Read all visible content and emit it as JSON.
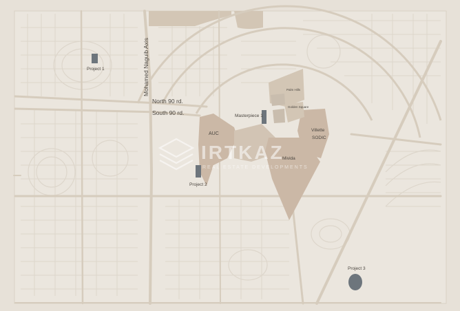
{
  "colors": {
    "background": "#e7e1d8",
    "map_fill": "#ebe6de",
    "road_major": "#d6ccbd",
    "road_minor": "#dcd5ca",
    "block_fill": "#d3c6b5",
    "district_fill": "#cbb8a6",
    "project_marker": "#6d757c",
    "label_text": "#4c4741",
    "watermark": "#ffffff"
  },
  "roads": {
    "mohamed_naguib": "Mohamed Naguib Axis",
    "north_90": "North 90 rd.",
    "south_90": "South 90 rd."
  },
  "districts": {
    "auc": "AUC",
    "mivida": "Mivida",
    "villette": "Villette",
    "sodic": "SODIC",
    "palm_hills": "Palm Hills",
    "golden_square": "Golden Square"
  },
  "projects": {
    "project_1": "Project 1",
    "project_2": "Project 2",
    "project_3": "Project 3",
    "masterpiece_1": "Masterpiece 1"
  },
  "watermark": {
    "brand": "IRTKAZ",
    "tagline": "REAL ESTATE DEVELOPMENTS",
    "icon": "stacked-layers-icon"
  }
}
